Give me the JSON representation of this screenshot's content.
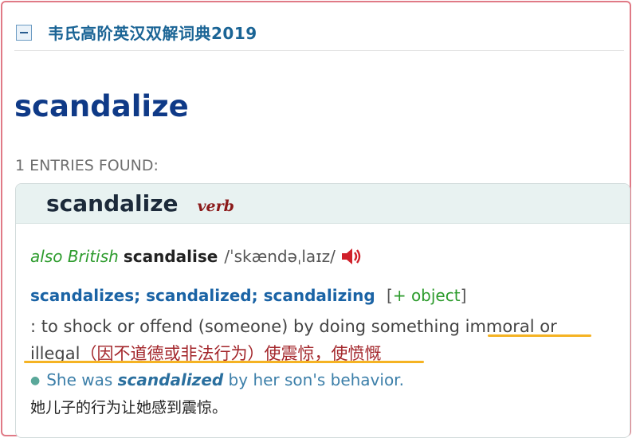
{
  "dictionary": {
    "title": "韦氏高阶英汉双解词典2019",
    "collapse_symbol": "−"
  },
  "headword": "scandalize",
  "entries_found": "1 ENTRIES FOUND:",
  "entry": {
    "word": "scandalize",
    "pos": "verb",
    "variant": {
      "label": "also British",
      "word": "scandalise",
      "pronunciation": "/ˈskændəˌlaɪz/",
      "audio_icon": "speaker-icon"
    },
    "forms": "scandalizes; scandalized; scandalizing",
    "grammar": {
      "open": "[",
      "text": "+ object",
      "close": "]"
    },
    "definition": {
      "en_part1": ": to shock or offend (someone) by doing something ",
      "en_highlight1": "immoral or",
      "en_highlight2": "illegal",
      "zh": "（因不道德或非法行为）使震惊，使愤慨"
    },
    "example": {
      "before": "She was ",
      "emph": "scandalized",
      "after": " by her son's behavior.",
      "translation": "她儿子的行为让她感到震惊。"
    }
  },
  "colors": {
    "title": "#1a6495",
    "headword": "#0f3a87",
    "pos": "#8b1a1a",
    "green_label": "#2c9b2c",
    "forms": "#1a63a5",
    "zh_def": "#a3262b",
    "highlight_underline": "#f5b323",
    "frame_border": "#e07a86"
  }
}
